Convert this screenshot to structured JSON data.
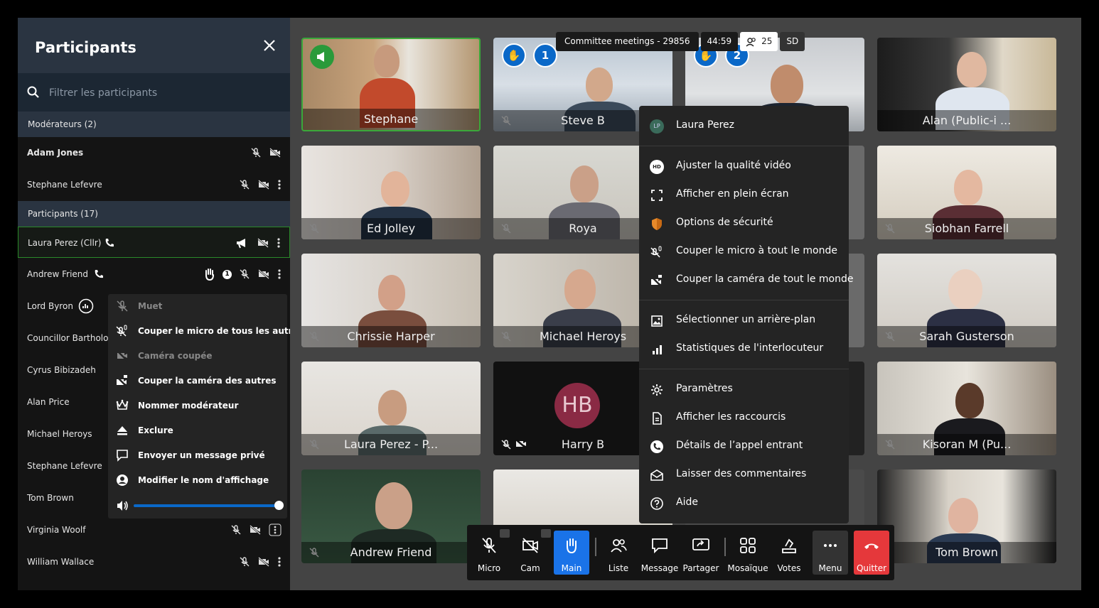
{
  "sidebar": {
    "title": "Participants",
    "search_placeholder": "Filtrer les participants",
    "moderators_header": "Modérateurs (2)",
    "participants_header": "Participants  (17)",
    "moderators": [
      "Adam Jones",
      "Stephane Lefevre"
    ],
    "participants": [
      "Laura Perez (Cllr)",
      "Andrew Friend",
      "Lord Byron",
      "Councillor Bartholon",
      "Cyrus Bibizadeh",
      "Alan Price",
      "Michael Heroys",
      "Stephane Lefevre",
      "Tom Brown",
      "Virginia Woolf",
      "William Wallace"
    ],
    "raise_count": "1"
  },
  "context_menu": {
    "items": [
      "Muet",
      "Couper le micro de tous les autres",
      "Caméra coupée",
      "Couper la caméra des autres",
      "Nommer modérateur",
      "Exclure",
      "Envoyer un message privé",
      "Modifier le nom d'affichage"
    ],
    "volume": 1.0
  },
  "topbar": {
    "meeting": "Committee meetings - 29856",
    "timer": "44:59",
    "count": "25",
    "quality": "SD"
  },
  "tiles": {
    "names": [
      "Stephane",
      "Steve B",
      "",
      "Alan (Public-i ...",
      "Ed Jolley",
      "Roya",
      "",
      "Siobhan Farrell",
      "Chrissie Harper",
      "Michael Heroys",
      "",
      "Sarah Gusterson",
      "Laura Perez - P...",
      "Harry B",
      "",
      "Kisoran M (Pu...",
      "Andrew Friend",
      "",
      "",
      "Tom Brown"
    ],
    "avatar_initials": "HB",
    "raise_1": "1",
    "raise_2": "2"
  },
  "menu": {
    "user_initials": "LP",
    "user_name": "Laura Perez",
    "hd_badge": "HD",
    "items": [
      "Ajuster la qualité vidéo",
      "Afficher en plein écran",
      "Options de sécurité",
      "Couper le micro à tout le monde",
      "Couper la caméra de tout le monde",
      "Sélectionner un arrière-plan",
      "Statistiques de l'interlocuteur",
      "Paramètres",
      "Afficher les raccourcis",
      "Détails de l’appel entrant",
      "Laisser des commentaires",
      "Aide"
    ]
  },
  "toolbar": {
    "labels": [
      "Micro",
      "Cam",
      "Main",
      "Liste",
      "Message",
      "Partager",
      "Mosaïque",
      "Votes",
      "Menu",
      "Quitter"
    ],
    "active_color": "#1a73e8",
    "leave_color": "#e5383b"
  }
}
